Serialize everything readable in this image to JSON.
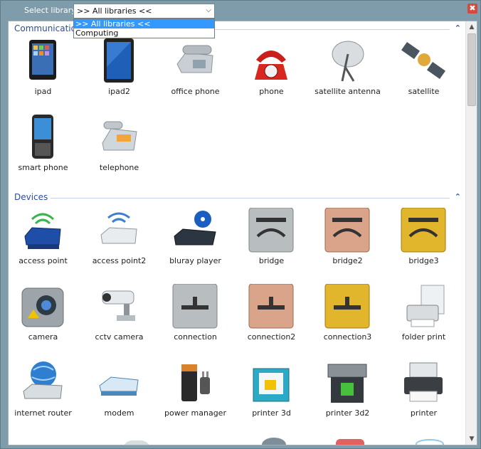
{
  "toolbar": {
    "select_label": "Select library",
    "selected_library": ">> All libraries <<",
    "close_glyph": "✖"
  },
  "dropdown": {
    "options": [
      ">> All libraries <<",
      "Computing"
    ]
  },
  "sections": {
    "communications": {
      "title": "Communications"
    },
    "devices": {
      "title": "Devices"
    }
  },
  "icons": {
    "ipad": "ipad",
    "ipad2": "ipad2",
    "office_phone": "office phone",
    "phone": "phone",
    "satellite_antenna": "satellite antenna",
    "satellite": "satellite",
    "smart_phone": "smart phone",
    "telephone": "telephone",
    "access_point": "access point",
    "access_point2": "access point2",
    "bluray_player": "bluray player",
    "bridge": "bridge",
    "bridge2": "bridge2",
    "bridge3": "bridge3",
    "camera": "camera",
    "cctv_camera": "cctv camera",
    "connection": "connection",
    "connection2": "connection2",
    "connection3": "connection3",
    "folder_print": "folder print",
    "internet_router": "internet router",
    "modem": "modem",
    "power_manager": "power manager",
    "printer_3d": "printer 3d",
    "printer_3d2": "printer 3d2",
    "printer": "printer"
  },
  "colors": {
    "frame": "#7e9ca9",
    "section_title": "#2a4d9e",
    "selection": "#3399ff",
    "close": "#d6493d"
  }
}
